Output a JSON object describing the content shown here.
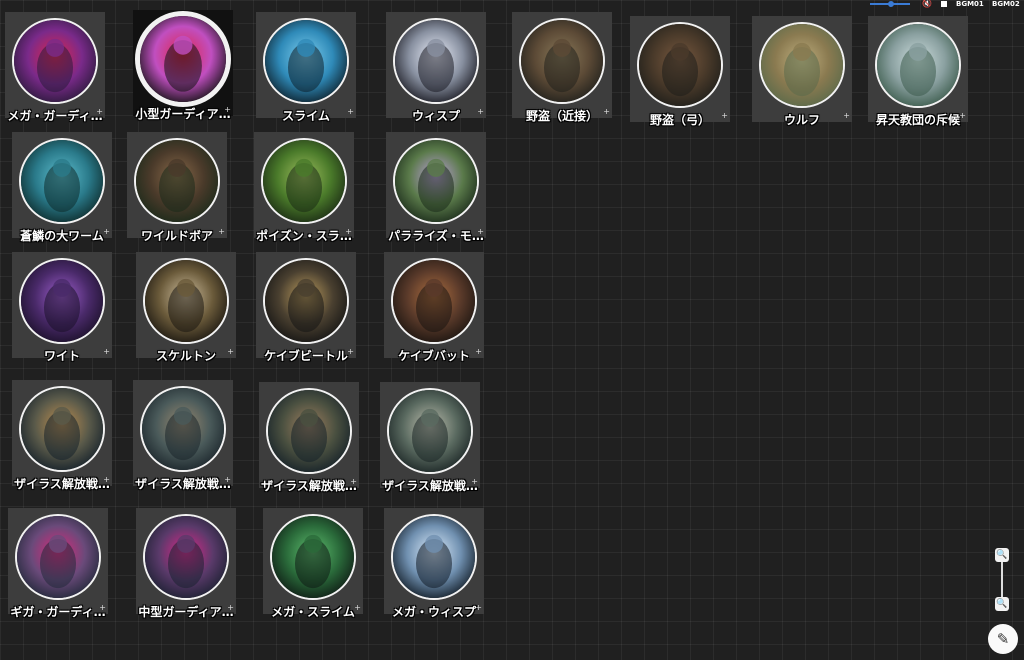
{
  "controls": {
    "volume_level": 0.5,
    "mute_icon": "volume-mute-icon",
    "stop_icon": "stop-icon",
    "bgm_labels": [
      "BGM01",
      "BGM02"
    ]
  },
  "tokens": [
    {
      "id": "t1",
      "label": "メガ・ガーディ…",
      "palette": [
        "#2a1a3a",
        "#7a2a8a",
        "#e0264a"
      ]
    },
    {
      "id": "t2",
      "label": "小型ガーディア…",
      "palette": [
        "#111",
        "#c04fc0",
        "#e0264a"
      ],
      "selected": true
    },
    {
      "id": "t3",
      "label": "スライム",
      "palette": [
        "#0d1f2a",
        "#2f8ab8",
        "#7fd0f0"
      ]
    },
    {
      "id": "t4",
      "label": "ウィスプ",
      "palette": [
        "#1a1a22",
        "#8890a0",
        "#f0f4ff"
      ]
    },
    {
      "id": "t5",
      "label": "野盗（近接）",
      "palette": [
        "#20201c",
        "#5c4a36",
        "#8a7a5a"
      ]
    },
    {
      "id": "t6",
      "label": "野盗（弓）",
      "palette": [
        "#1e1e1a",
        "#4a3a2a",
        "#7a5a40"
      ]
    },
    {
      "id": "t7",
      "label": "ウルフ",
      "palette": [
        "#5a6a4a",
        "#8a7a50",
        "#c0b080"
      ]
    },
    {
      "id": "t8",
      "label": "昇天教団の斥候",
      "palette": [
        "#3a5a4a",
        "#8aa0a0",
        "#d0e0e0"
      ]
    },
    {
      "id": "t9",
      "label": "蒼鱗の大ワーム",
      "palette": [
        "#0d2a2a",
        "#2a7a8a",
        "#60c0d0"
      ]
    },
    {
      "id": "t10",
      "label": "ワイルドボア",
      "palette": [
        "#1a2a1a",
        "#4a3a2a",
        "#8a6a4a"
      ]
    },
    {
      "id": "t11",
      "label": "ポイズン・スラ…",
      "palette": [
        "#1a2a14",
        "#4a7a2a",
        "#a0c060"
      ]
    },
    {
      "id": "t12",
      "label": "パラライズ・モ…",
      "palette": [
        "#1a2a1a",
        "#5a7a4a",
        "#c0a0e0"
      ]
    },
    {
      "id": "t13",
      "label": "ワイト",
      "palette": [
        "#1a1028",
        "#4a2a6a",
        "#a060d0"
      ]
    },
    {
      "id": "t14",
      "label": "スケルトン",
      "palette": [
        "#1a1610",
        "#6a5a3a",
        "#d0c0a0"
      ]
    },
    {
      "id": "t15",
      "label": "ケイブビートル",
      "palette": [
        "#141414",
        "#4a4030",
        "#c0a060"
      ]
    },
    {
      "id": "t16",
      "label": "ケイブバット",
      "palette": [
        "#1a1410",
        "#5a3a2a",
        "#b07040"
      ]
    },
    {
      "id": "t17",
      "label": "ザイラス解放戦…",
      "palette": [
        "#14202a",
        "#5a5a4a",
        "#c09050"
      ]
    },
    {
      "id": "t18",
      "label": "ザイラス解放戦…",
      "palette": [
        "#1a242a",
        "#4a5a5a",
        "#9a8a70"
      ]
    },
    {
      "id": "t19",
      "label": "ザイラス解放戦…",
      "palette": [
        "#142028",
        "#4a5040",
        "#a08060"
      ]
    },
    {
      "id": "t20",
      "label": "ザイラス解放戦…",
      "palette": [
        "#1a2424",
        "#5a6a60",
        "#c0c0b0"
      ]
    },
    {
      "id": "t21",
      "label": "ギガ・ガーディ…",
      "palette": [
        "#202838",
        "#6a4a7a",
        "#e0267a"
      ]
    },
    {
      "id": "t22",
      "label": "中型ガーディア…",
      "palette": [
        "#1a2030",
        "#5a3a6a",
        "#e0268a"
      ]
    },
    {
      "id": "t23",
      "label": "メガ・スライム",
      "palette": [
        "#0e1a14",
        "#2a6a3a",
        "#60c070"
      ]
    },
    {
      "id": "t24",
      "label": "メガ・ウィスプ",
      "palette": [
        "#101a24",
        "#7090b0",
        "#e0f0ff"
      ]
    }
  ],
  "zoom": {
    "in_icon": "zoom-in-icon",
    "out_icon": "zoom-out-icon"
  },
  "edit_icon": "pencil-icon"
}
